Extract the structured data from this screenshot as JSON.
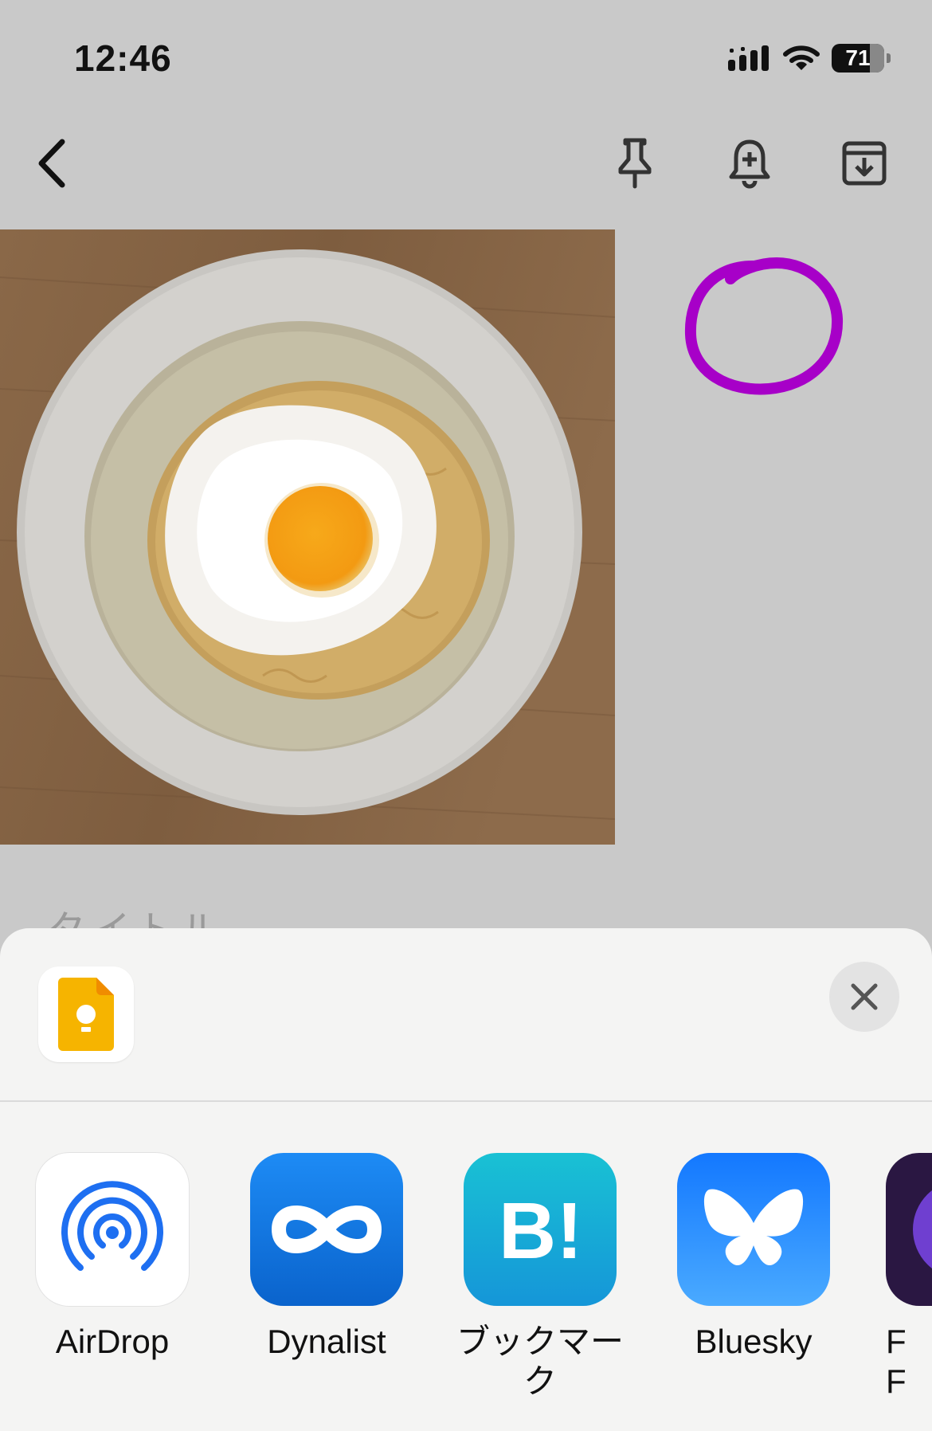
{
  "status_bar": {
    "time": "12:46",
    "battery": "71"
  },
  "sheet": {
    "source_app_icon": "google-keep-icon",
    "share_targets": [
      {
        "label": "AirDrop",
        "icon": "airdrop-icon"
      },
      {
        "label": "Dynalist",
        "icon": "dynalist-icon"
      },
      {
        "label": "ブックマーク",
        "icon": "hatena-bookmark-icon"
      },
      {
        "label": "Bluesky",
        "icon": "bluesky-icon"
      },
      {
        "label": "F\nF",
        "icon": "partial-app-icon"
      }
    ]
  },
  "colors": {
    "drawing_stroke": "#a700c8",
    "airdrop_blue": "#1e6ff1",
    "dynalist_blue": "#1677e6",
    "hatena_teal": "#16a6d6",
    "bluesky_blue": "#1a8cff",
    "keep_yellow": "#f6b400"
  }
}
